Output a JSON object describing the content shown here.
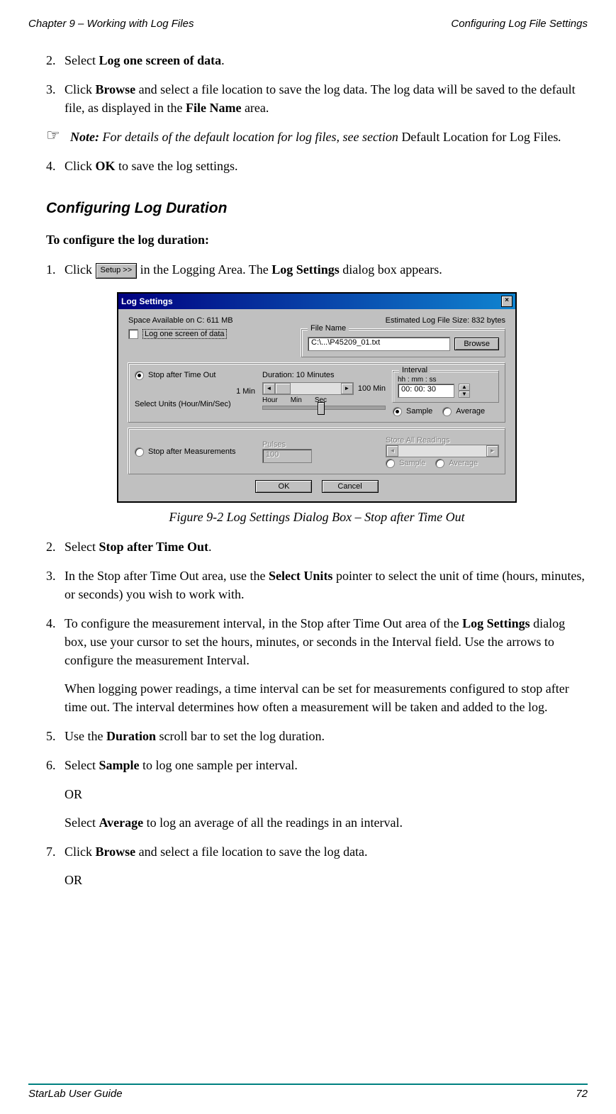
{
  "header": {
    "left": "Chapter 9 – Working with Log Files",
    "right": "Configuring Log File Settings"
  },
  "steps_top": {
    "2": {
      "num": "2.",
      "pre": "Select ",
      "bold": "Log one screen of data",
      "post": "."
    },
    "3": {
      "num": "3.",
      "pre": "Click ",
      "bold1": "Browse",
      "mid": " and select a file location to save the log data. The log data will be saved to the default file, as displayed in the ",
      "bold2": "File Name",
      "post": " area."
    },
    "4": {
      "num": "4.",
      "pre": "Click ",
      "bold": "OK",
      "post": " to save the log settings."
    }
  },
  "note": {
    "icon": "☞",
    "label": "Note:",
    "italic_pre": " For details of the default location for log files, see section ",
    "plain": "Default Location for Log Files",
    "italic_post": "."
  },
  "section_heading": "Configuring Log Duration",
  "sub_heading": "To configure the log duration:",
  "step1": {
    "num": "1.",
    "pre": "Click ",
    "btn": "Setup >>",
    "mid": " in the Logging Area. The ",
    "bold": "Log Settings",
    "post": " dialog box appears."
  },
  "dialog": {
    "title": "Log Settings",
    "close": "×",
    "space": "Space Available on C: 611 MB",
    "est": "Estimated Log File Size: 832 bytes",
    "log_one_screen": "Log one screen of data",
    "filename_label": "File Name",
    "filename_value": "C:\\...\\P45209_01.txt",
    "browse": "Browse",
    "stop_timeout": "Stop after Time Out",
    "duration_label": "Duration: 10 Minutes",
    "min1": "1 Min",
    "min100": "100 Min",
    "select_units": "Select Units (Hour/Min/Sec)",
    "hour": "Hour",
    "min": "Min",
    "sec": "Sec",
    "interval_label": "Interval",
    "interval_fmt": "hh : mm : ss",
    "interval_val": "00: 00: 30",
    "sample": "Sample",
    "average": "Average",
    "stop_meas": "Stop after Measurements",
    "pulses": "Pulses",
    "pulses_val": "100",
    "store_all": "Store All Readings",
    "ok": "OK",
    "cancel": "Cancel"
  },
  "figure_caption": "Figure 9-2 Log Settings Dialog Box – Stop after Time Out",
  "steps_bottom": {
    "2": {
      "num": "2.",
      "pre": "Select ",
      "bold": "Stop after Time Out",
      "post": "."
    },
    "3": {
      "num": "3.",
      "pre": "In the Stop after Time Out area, use the ",
      "bold": "Select Units",
      "post": " pointer to select the unit of time (hours, minutes, or seconds) you wish to work with."
    },
    "4": {
      "num": "4.",
      "pre": "To configure the measurement interval, in the Stop after Time Out area of the ",
      "bold": "Log Settings",
      "post": " dialog box, use your cursor to set the hours, minutes, or seconds in the Interval field. Use the arrows to configure the measurement Interval.",
      "sub": "When logging power readings, a time interval can be set for measurements configured to stop after time out. The interval determines how often a measurement will be taken and added to the log."
    },
    "5": {
      "num": "5.",
      "pre": "Use the ",
      "bold": "Duration",
      "post": " scroll bar to set the log duration."
    },
    "6": {
      "num": "6.",
      "pre": "Select ",
      "bold": "Sample",
      "post": " to log one sample per interval.",
      "or": "OR",
      "pre2": "Select ",
      "bold2": "Average",
      "post2": " to log an average of all the readings in an interval."
    },
    "7": {
      "num": "7.",
      "pre": "Click ",
      "bold": "Browse",
      "post": " and select a file location to save the log data.",
      "or": "OR"
    }
  },
  "footer": {
    "left": "StarLab User Guide",
    "right": "72"
  }
}
